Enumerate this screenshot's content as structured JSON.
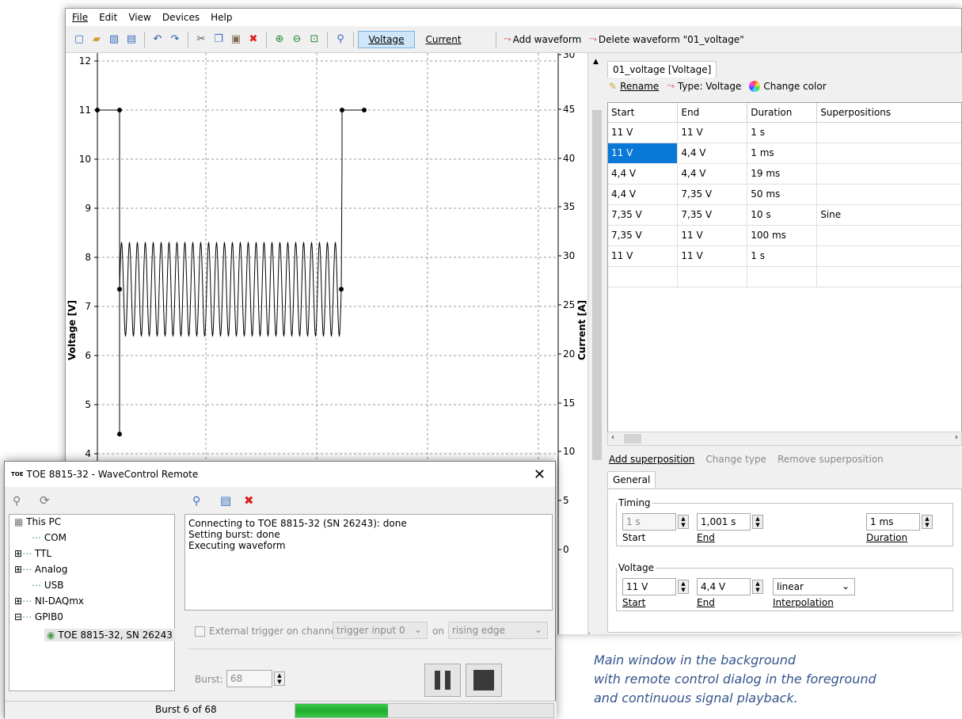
{
  "menu": [
    "File",
    "Edit",
    "View",
    "Devices",
    "Help"
  ],
  "toolbar": {
    "voltage_label": "Voltage",
    "current_label": "Current",
    "add_waveform": "Add waveform",
    "delete_waveform": "Delete waveform \"01_voltage\""
  },
  "plot": {
    "y_left_label": "Voltage [V]",
    "y_right_label": "Current [A]",
    "y_left_ticks": [
      "12",
      "11",
      "10",
      "9",
      "8",
      "7",
      "6",
      "5",
      "4"
    ],
    "y_right_ticks": [
      "30",
      "45",
      "40",
      "35",
      "30",
      "25",
      "20",
      "15",
      "10",
      "5",
      "0"
    ]
  },
  "waveform_tab": "01_voltage [Voltage]",
  "rtoolbar": {
    "rename": "Rename",
    "type": "Type: Voltage",
    "change_color": "Change color"
  },
  "table": {
    "headers": [
      "Start",
      "End",
      "Duration",
      "Superpositions"
    ],
    "rows": [
      [
        "11 V",
        "11 V",
        "1 s",
        ""
      ],
      [
        "11 V",
        "4,4 V",
        "1 ms",
        ""
      ],
      [
        "4,4 V",
        "4,4 V",
        "19 ms",
        ""
      ],
      [
        "4,4 V",
        "7,35 V",
        "50 ms",
        ""
      ],
      [
        "7,35 V",
        "7,35 V",
        "10 s",
        "Sine"
      ],
      [
        "7,35 V",
        "11 V",
        "100 ms",
        ""
      ],
      [
        "11 V",
        "11 V",
        "1 s",
        ""
      ]
    ]
  },
  "superposition": {
    "add": "Add superposition",
    "change_type": "Change type",
    "remove": "Remove superposition"
  },
  "general": {
    "tab": "General",
    "timing_legend": "Timing",
    "start_value": "1 s",
    "start_label": "Start",
    "end_value": "1,001 s",
    "end_label": "End",
    "duration_value": "1 ms",
    "duration_label": "Duration",
    "voltage_legend": "Voltage",
    "v_start_value": "11 V",
    "v_start_label": "Start",
    "v_end_value": "4,4 V",
    "v_end_label": "End",
    "interp_value": "linear",
    "interp_label": "Interpolation"
  },
  "dialog": {
    "title": "TOE 8815-32 - WaveControl Remote",
    "tree": [
      "This PC",
      "COM",
      "TTL",
      "Analog",
      "USB",
      "NI-DAQmx",
      "GPIB0",
      "TOE 8815-32, SN 26243"
    ],
    "log": [
      "Connecting to TOE 8815-32 (SN 26243): done",
      "Setting burst: done",
      "Executing waveform"
    ],
    "ext_trigger": "External trigger on channel",
    "trigger_select": "trigger input 0",
    "on": "on",
    "edge_select": "rising edge",
    "burst_label": "Burst:",
    "burst_value": "68",
    "status": "Burst 6 of 68",
    "progress": 0.36
  },
  "caption": [
    "Main window in the background",
    "with remote control dialog in the foreground",
    "and continuous signal playback."
  ]
}
